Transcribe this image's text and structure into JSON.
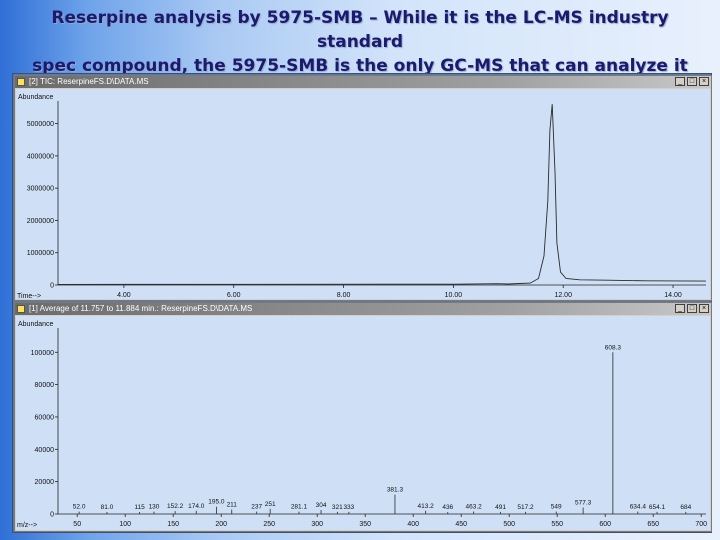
{
  "slide": {
    "title_line1": "Reserpine analysis by 5975-SMB – While it is the LC-MS industry standard",
    "title_line2": "spec compound, the 5975-SMB is the only GC-MS that can analyze it"
  },
  "colors": {
    "plot_bg": "#cfe0f6",
    "trace": "#2a2a2a",
    "title_text": "#1a1a6e",
    "window_frame": "#d4d0c8"
  },
  "window_top": {
    "title": "[2] TIC: ReserpineFS.D\\DATA.MS",
    "buttons": [
      "_",
      "□",
      "×"
    ]
  },
  "window_bottom": {
    "title": "[1] Average of 11.757 to 11.884 min.: ReserpineFS.D\\DATA.MS",
    "buttons": [
      "_",
      "□",
      "×"
    ]
  },
  "chart_data": [
    {
      "type": "line",
      "ylabel": "Abundance",
      "xlabel": "Time-->",
      "y_ticks": [
        0,
        1000000,
        2000000,
        3000000,
        4000000,
        5000000
      ],
      "y_tick_labels": [
        "0",
        "1000000",
        "2000000",
        "3000000",
        "4000000",
        "5000000"
      ],
      "x_ticks": [
        4,
        6,
        8,
        10,
        12,
        14
      ],
      "x_tick_labels": [
        "4.00",
        "6.00",
        "8.00",
        "10.00",
        "12.00",
        "14.00"
      ],
      "xlim": [
        2.8,
        14.6
      ],
      "ylim": [
        0,
        5700000
      ],
      "series": [
        {
          "x": [
            2.8,
            10.0,
            10.8,
            11.0,
            11.2,
            11.4,
            11.55,
            11.65,
            11.72,
            11.757,
            11.8,
            11.85,
            11.884,
            11.95,
            12.05,
            12.3,
            12.8,
            13.5,
            14.6
          ],
          "y": [
            20000,
            25000,
            40000,
            30000,
            45000,
            60000,
            200000,
            900000,
            2600000,
            4800000,
            5600000,
            3500000,
            1300000,
            400000,
            200000,
            160000,
            150000,
            130000,
            120000
          ]
        }
      ]
    },
    {
      "type": "bar",
      "ylabel": "Abundance",
      "xlabel": "m/z-->",
      "y_ticks": [
        0,
        20000,
        40000,
        60000,
        80000,
        100000
      ],
      "y_tick_labels": [
        "0",
        "20000",
        "40000",
        "60000",
        "80000",
        "100000"
      ],
      "x_ticks": [
        50,
        100,
        150,
        200,
        250,
        300,
        350,
        400,
        450,
        500,
        550,
        600,
        650,
        700
      ],
      "x_tick_labels": [
        "50",
        "100",
        "150",
        "200",
        "250",
        "300",
        "350",
        "400",
        "450",
        "500",
        "550",
        "600",
        "650",
        "700"
      ],
      "xlim": [
        30,
        705
      ],
      "ylim": [
        0,
        115000
      ],
      "peaks": [
        {
          "mz": 52,
          "ab": 1500
        },
        {
          "mz": 81,
          "ab": 1200
        },
        {
          "mz": 115,
          "ab": 1200
        },
        {
          "mz": 130,
          "ab": 1500
        },
        {
          "mz": 152,
          "ab": 1800
        },
        {
          "mz": 174,
          "ab": 2000
        },
        {
          "mz": 195,
          "ab": 4500
        },
        {
          "mz": 211,
          "ab": 2800
        },
        {
          "mz": 237,
          "ab": 1500
        },
        {
          "mz": 251,
          "ab": 3200
        },
        {
          "mz": 281,
          "ab": 1500
        },
        {
          "mz": 304,
          "ab": 2500
        },
        {
          "mz": 321,
          "ab": 1300
        },
        {
          "mz": 333,
          "ab": 1300
        },
        {
          "mz": 381,
          "ab": 12000
        },
        {
          "mz": 413,
          "ab": 2000
        },
        {
          "mz": 436,
          "ab": 1200
        },
        {
          "mz": 463,
          "ab": 1500
        },
        {
          "mz": 491,
          "ab": 1300
        },
        {
          "mz": 517,
          "ab": 1300
        },
        {
          "mz": 549,
          "ab": 1500
        },
        {
          "mz": 577,
          "ab": 4000
        },
        {
          "mz": 608,
          "ab": 100000
        },
        {
          "mz": 634,
          "ab": 1500
        },
        {
          "mz": 654,
          "ab": 1300
        },
        {
          "mz": 684,
          "ab": 1300
        }
      ],
      "peak_labels": [
        {
          "mz": 52,
          "text": "52.0"
        },
        {
          "mz": 81,
          "text": "81.0"
        },
        {
          "mz": 115,
          "text": "115"
        },
        {
          "mz": 130,
          "text": "130"
        },
        {
          "mz": 152,
          "text": "152.2"
        },
        {
          "mz": 174,
          "text": "174.0"
        },
        {
          "mz": 195,
          "text": "195.0"
        },
        {
          "mz": 211,
          "text": "211"
        },
        {
          "mz": 237,
          "text": "237"
        },
        {
          "mz": 251,
          "text": "251"
        },
        {
          "mz": 281,
          "text": "281.1"
        },
        {
          "mz": 304,
          "text": "304"
        },
        {
          "mz": 321,
          "text": "321"
        },
        {
          "mz": 333,
          "text": "333"
        },
        {
          "mz": 381,
          "text": "381.3"
        },
        {
          "mz": 413,
          "text": "413.2"
        },
        {
          "mz": 436,
          "text": "436"
        },
        {
          "mz": 463,
          "text": "463.2"
        },
        {
          "mz": 491,
          "text": "491"
        },
        {
          "mz": 517,
          "text": "517.2"
        },
        {
          "mz": 549,
          "text": "549"
        },
        {
          "mz": 577,
          "text": "577.3"
        },
        {
          "mz": 608,
          "text": "608.3"
        },
        {
          "mz": 634,
          "text": "634.4"
        },
        {
          "mz": 654,
          "text": "654.1"
        },
        {
          "mz": 684,
          "text": "684"
        }
      ]
    }
  ]
}
